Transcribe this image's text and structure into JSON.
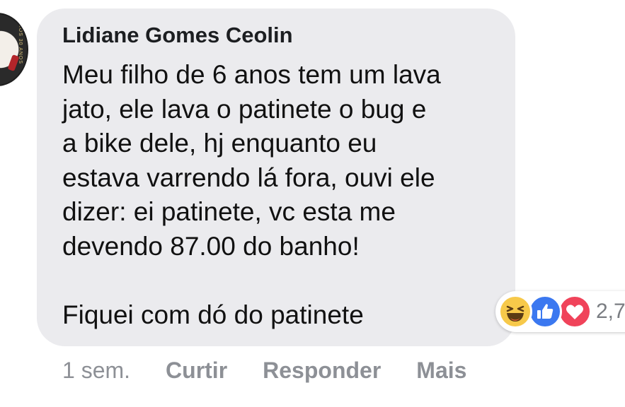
{
  "comment": {
    "author": "Lidiane Gomes Ceolin",
    "text": "Meu filho de 6 anos tem um lava\njato, ele lava o patinete o bug e\na bike dele, hj enquanto eu\nestava varrendo lá fora, ouvi ele\ndizer: ei patinete, vc esta me\ndevendo 87.00 do banho!\n\nFiquei com dó do patinete",
    "bubble_color": "#ebebee"
  },
  "avatar": {
    "seal_text": "SOS 30 ANOS"
  },
  "reactions": {
    "icons": [
      "haha-icon",
      "like-icon",
      "love-icon"
    ],
    "count": "2,7",
    "colors": {
      "haha": "#f7c94a",
      "like": "#3b78f0",
      "love": "#f0435a"
    }
  },
  "actions": {
    "time": "1 sem.",
    "like": "Curtir",
    "reply": "Responder",
    "more": "Mais",
    "color": "#8d9096"
  }
}
